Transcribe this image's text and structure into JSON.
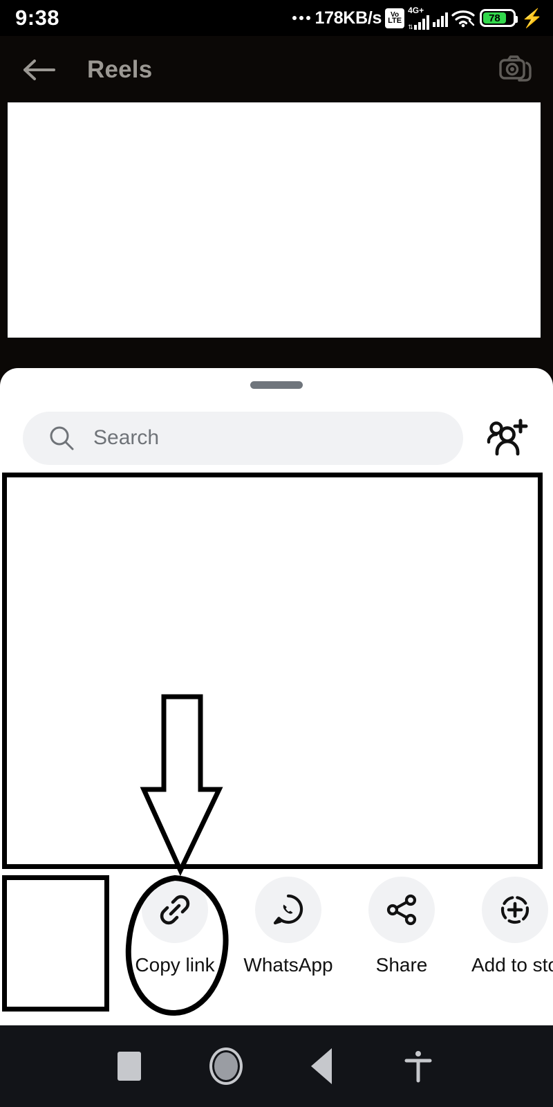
{
  "status_bar": {
    "time": "9:38",
    "network_speed": "178KB/s",
    "volte_top": "Vo",
    "volte_bottom": "LTE",
    "network_type": "4G+",
    "battery_percent": "78",
    "icons": [
      "overflow-dots",
      "volte-badge",
      "signal-bars-primary",
      "signal-bars-secondary",
      "wifi-icon",
      "battery-icon",
      "charging-bolt-icon"
    ]
  },
  "header": {
    "title": "Reels",
    "back_icon": "back-arrow-icon",
    "camera_icon": "camera-icon",
    "title_color": "#9b9893"
  },
  "share_sheet": {
    "drag_handle": "drag-handle",
    "search": {
      "placeholder": "Search",
      "icon": "search-icon"
    },
    "add_people_icon": "add-people-icon",
    "targets": [
      {
        "label": "Copy link",
        "icon": "link-icon",
        "highlighted": true
      },
      {
        "label": "WhatsApp",
        "icon": "whatsapp-icon",
        "highlighted": false
      },
      {
        "label": "Share",
        "icon": "share-nodes-icon",
        "highlighted": false
      },
      {
        "label": "Add to sto",
        "icon": "add-to-story-icon",
        "highlighted": false
      }
    ]
  },
  "annotations": {
    "arrow": "down-arrow-pointing-to-copy-link",
    "ellipse": "ellipse-highlighting-copy-link",
    "stroke_color": "#000000"
  },
  "nav_bar": {
    "items": [
      {
        "label": "Recents",
        "icon": "square-icon"
      },
      {
        "label": "Home",
        "icon": "circle-icon"
      },
      {
        "label": "Back",
        "icon": "triangle-back-icon"
      },
      {
        "label": "Accessibility",
        "icon": "accessibility-icon"
      }
    ]
  },
  "colors": {
    "sheet_bg": "#ffffff",
    "chip_bg": "#f1f2f4",
    "nav_bg": "#121418",
    "battery_green": "#32d74b"
  }
}
